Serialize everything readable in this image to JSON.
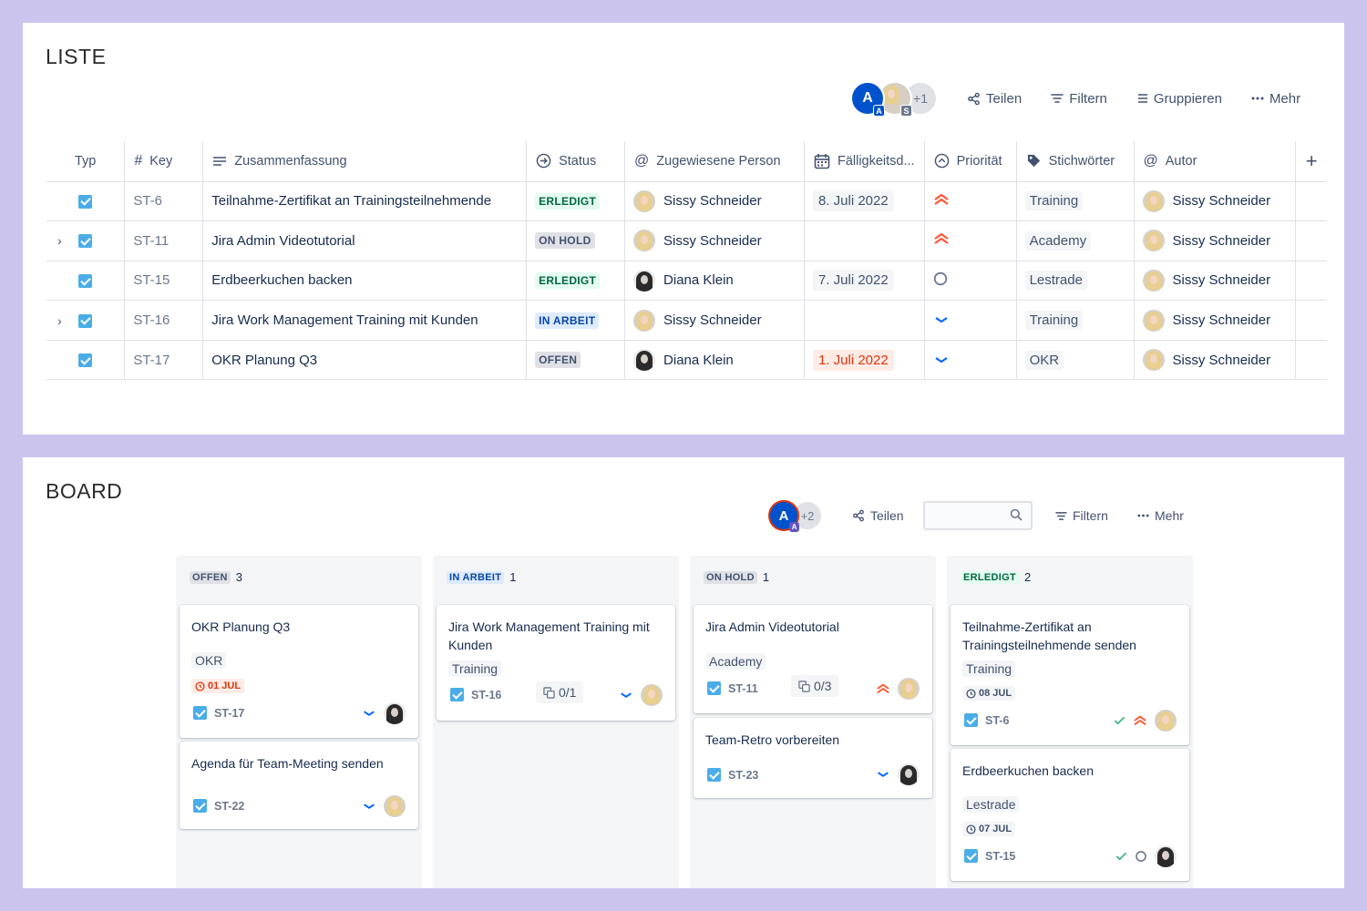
{
  "list": {
    "title": "LISTE",
    "toolbar": {
      "avatar_initial": "A",
      "avatar_badge_a": "A",
      "avatar_badge_s": "S",
      "more_count": "+1",
      "share": "Teilen",
      "filter": "Filtern",
      "group": "Gruppieren",
      "more": "Mehr"
    },
    "columns": {
      "typ": "Typ",
      "key": "Key",
      "summary": "Zusammenfassung",
      "status": "Status",
      "assignee": "Zugewiesene Person",
      "due": "Fälligkeitsd...",
      "priority": "Priorität",
      "labels": "Stichwörter",
      "author": "Autor",
      "add": "+"
    },
    "rows": [
      {
        "key": "ST-6",
        "summary": "Teilnahme-Zertifikat an Trainingsteilnehmende",
        "status": "ERLEDIGT",
        "assignee": "Sissy Schneider",
        "due": "8. Juli 2022",
        "priority": "highest",
        "label": "Training",
        "author": "Sissy Schneider"
      },
      {
        "key": "ST-11",
        "summary": "Jira Admin Videotutorial",
        "status": "ON HOLD",
        "assignee": "Sissy Schneider",
        "due": "",
        "priority": "highest",
        "label": "Academy",
        "author": "Sissy Schneider"
      },
      {
        "key": "ST-15",
        "summary": "Erdbeerkuchen backen",
        "status": "ERLEDIGT",
        "assignee": "Diana Klein",
        "due": "7. Juli 2022",
        "priority": "medium",
        "label": "Lestrade",
        "author": "Sissy Schneider"
      },
      {
        "key": "ST-16",
        "summary": "Jira Work Management Training mit Kunden",
        "status": "IN ARBEIT",
        "assignee": "Sissy Schneider",
        "due": "",
        "priority": "low",
        "label": "Training",
        "author": "Sissy Schneider"
      },
      {
        "key": "ST-17",
        "summary": "OKR Planung Q3",
        "status": "OFFEN",
        "assignee": "Diana Klein",
        "due": "1. Juli 2022",
        "priority": "low",
        "label": "OKR",
        "author": "Sissy Schneider"
      }
    ]
  },
  "board": {
    "title": "BOARD",
    "toolbar": {
      "avatar_initial": "A",
      "avatar_badge": "A",
      "more_count": "+2",
      "share": "Teilen",
      "search_placeholder": "",
      "filter": "Filtern",
      "more": "Mehr"
    },
    "columns": [
      {
        "status": "OFFEN",
        "count": "3",
        "cards": [
          {
            "title": "OKR Planung Q3",
            "label": "OKR",
            "due": "01 JUL",
            "key": "ST-17"
          },
          {
            "title": "Agenda für Team-Meeting senden",
            "key": "ST-22"
          }
        ]
      },
      {
        "status": "IN ARBEIT",
        "count": "1",
        "cards": [
          {
            "title": "Jira Work Management Training mit Kunden",
            "label": "Training",
            "subtasks": "0/1",
            "key": "ST-16"
          }
        ]
      },
      {
        "status": "ON HOLD",
        "count": "1",
        "cards": [
          {
            "title": "Jira Admin Videotutorial",
            "label": "Academy",
            "subtasks": "0/3",
            "key": "ST-11"
          },
          {
            "title": "Team-Retro vorbereiten",
            "key": "ST-23"
          }
        ]
      },
      {
        "status": "ERLEDIGT",
        "count": "2",
        "cards": [
          {
            "title": "Teilnahme-Zertifikat an Trainingsteilnehmende senden",
            "label": "Training",
            "due": "08 JUL",
            "key": "ST-6"
          },
          {
            "title": "Erdbeerkuchen backen",
            "label": "Lestrade",
            "due": "07 JUL",
            "key": "ST-15"
          }
        ]
      }
    ]
  },
  "colors": {
    "background": "#cbc5ee",
    "done_bg": "#e3fcef",
    "done_fg": "#006644",
    "progress_bg": "#deebff",
    "progress_fg": "#0747a6",
    "neutral_bg": "#dfe1e6",
    "neutral_fg": "#42526e",
    "overdue_bg": "#ffebe6",
    "overdue_fg": "#de350b",
    "priority_high": "#ff5630",
    "priority_low": "#0065ff",
    "task_icon": "#4bade8",
    "avatar_blue": "#0052cc"
  },
  "icons": {
    "share": "share-icon",
    "filter": "filter-icon",
    "group": "group-icon",
    "more": "more-icon",
    "task": "checkbox-icon",
    "priority_highest": "chevrons-up-icon",
    "priority_medium": "circle-icon",
    "priority_low": "chevron-down-icon",
    "clock": "clock-icon",
    "subtask": "subtask-icon",
    "search": "search-icon",
    "add_column": "plus-icon",
    "expand": "chevron-right-icon",
    "done": "check-icon"
  }
}
